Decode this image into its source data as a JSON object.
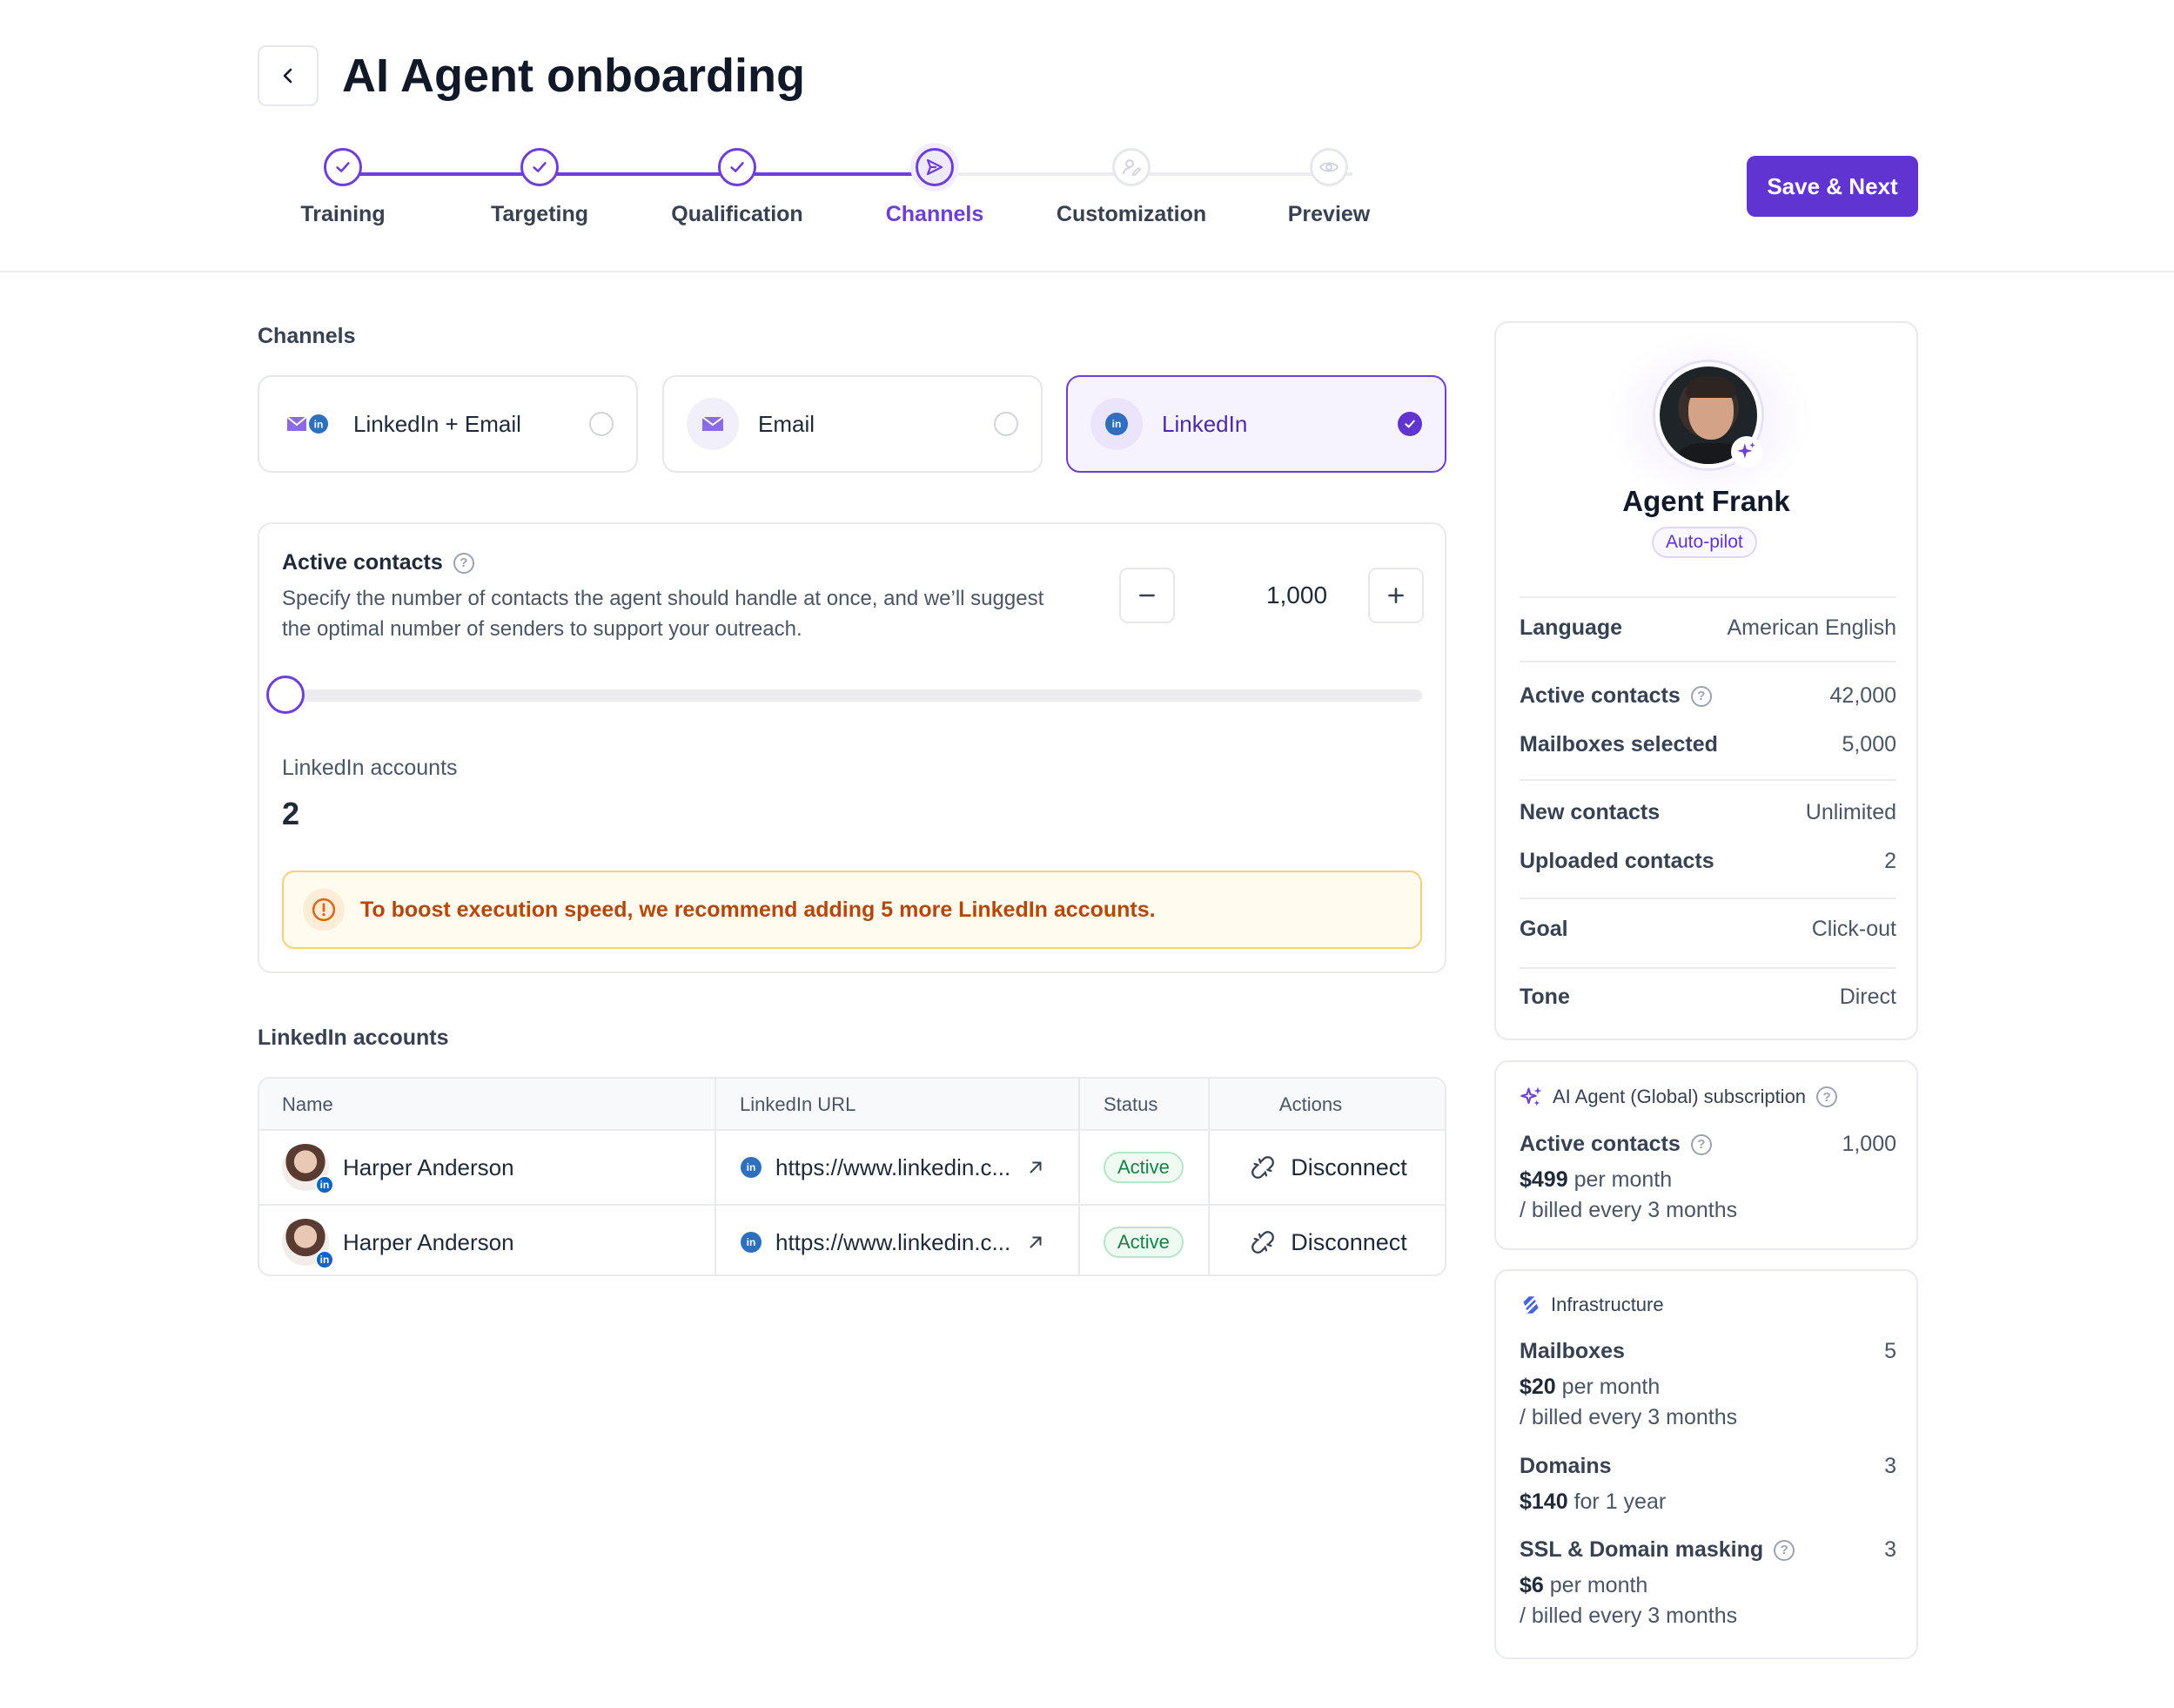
{
  "header": {
    "title": "AI Agent onboarding",
    "save_label": "Save & Next"
  },
  "steps": [
    {
      "label": "Training",
      "state": "done"
    },
    {
      "label": "Targeting",
      "state": "done"
    },
    {
      "label": "Qualification",
      "state": "done"
    },
    {
      "label": "Channels",
      "state": "current"
    },
    {
      "label": "Customization",
      "state": "todo"
    },
    {
      "label": "Preview",
      "state": "todo"
    }
  ],
  "channels": {
    "section_label": "Channels",
    "options": [
      {
        "label": "LinkedIn + Email",
        "selected": false
      },
      {
        "label": "Email",
        "selected": false
      },
      {
        "label": "LinkedIn",
        "selected": true
      }
    ]
  },
  "active_contacts": {
    "title": "Active contacts",
    "description": "Specify the number of contacts the agent should handle at once, and we’ll suggest the optimal number of senders to support your outreach.",
    "value": "1,000",
    "slider_fraction": 0,
    "linkedin_accounts_label": "LinkedIn accounts",
    "linkedin_accounts_value": "2",
    "warning": "To boost execution speed, we recommend adding 5 more LinkedIn accounts."
  },
  "accounts_table": {
    "title": "LinkedIn accounts",
    "columns": [
      "Name",
      "LinkedIn URL",
      "Status",
      "Actions"
    ],
    "rows": [
      {
        "name": "Harper Anderson",
        "url": "https://www.linkedin.c...",
        "status": "Active",
        "action": "Disconnect"
      },
      {
        "name": "Harper Anderson",
        "url": "https://www.linkedin.c...",
        "status": "Active",
        "action": "Disconnect"
      }
    ]
  },
  "profile": {
    "name": "Agent Frank",
    "mode": "Auto-pilot",
    "rows": [
      {
        "key": "Language",
        "value": "American English"
      },
      {
        "key": "Active contacts",
        "value": "42,000"
      },
      {
        "key": "Mailboxes selected",
        "value": "5,000"
      },
      {
        "key": "New contacts",
        "value": "Unlimited"
      },
      {
        "key": "Uploaded contacts",
        "value": "2"
      },
      {
        "key": "Goal",
        "value": "Click-out"
      },
      {
        "key": "Tone",
        "value": "Direct"
      }
    ]
  },
  "subscription": {
    "title": "AI Agent (Global) subscription",
    "key": "Active contacts",
    "value": "1,000",
    "price": "$499",
    "price_unit": "per month",
    "billing": "/ billed every 3 months"
  },
  "infrastructure": {
    "title": "Infrastructure",
    "items": [
      {
        "key": "Mailboxes",
        "value": "5",
        "price": "$20",
        "price_unit": "per month",
        "billing": "/ billed every 3 months"
      },
      {
        "key": "Domains",
        "value": "3",
        "price": "$140",
        "price_unit": "for 1 year",
        "billing": ""
      },
      {
        "key": "SSL & Domain masking",
        "value": "3",
        "price": "$6",
        "price_unit": "per month",
        "billing": "/ billed every 3 months"
      }
    ]
  },
  "colors": {
    "accent": "#6034d1",
    "success": "#178046",
    "warning": "#b4480b"
  }
}
